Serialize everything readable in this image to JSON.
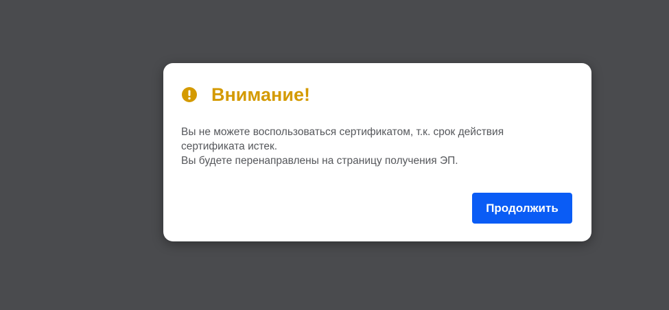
{
  "dialog": {
    "icon": "exclamation-circle-icon",
    "title": "Внимание!",
    "message_line1": "Вы не можете воспользоваться сертификатом, т.к. срок действия сертификата истек.",
    "message_line2": "Вы будете перенаправлены на страницу получения ЭП.",
    "continue_label": "Продолжить",
    "colors": {
      "title": "#d49a00",
      "button": "#0a5cf5",
      "backdrop": "#4a4b4e"
    }
  }
}
